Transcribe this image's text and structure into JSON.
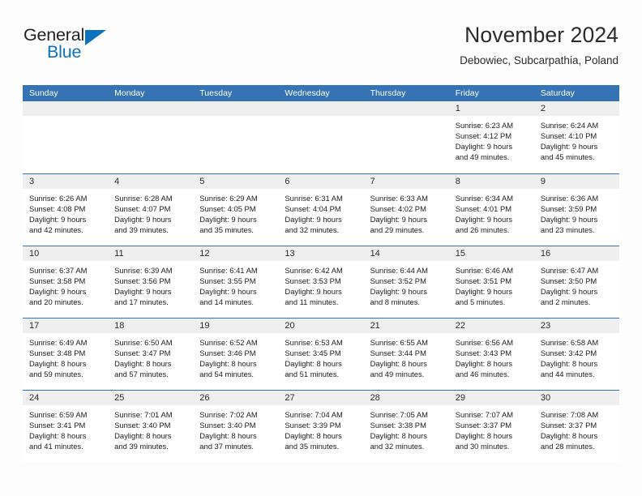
{
  "brand": {
    "name_part1": "General",
    "name_part2": "Blue",
    "triangle_color": "#0d72bb",
    "text_color": "#231f20"
  },
  "header": {
    "title": "November 2024",
    "subtitle": "Debowiec, Subcarpathia, Poland"
  },
  "colors": {
    "header_blue": "#3573b4",
    "date_strip_gray": "#efefef",
    "cell_white": "#ffffff",
    "page_background": "#fdfdfd",
    "text": "#1c1c1c"
  },
  "weekdays": [
    "Sunday",
    "Monday",
    "Tuesday",
    "Wednesday",
    "Thursday",
    "Friday",
    "Saturday"
  ],
  "weeks": [
    [
      {
        "day": "",
        "sunrise": "",
        "sunset": "",
        "daylight1": "",
        "daylight2": "",
        "empty": true
      },
      {
        "day": "",
        "sunrise": "",
        "sunset": "",
        "daylight1": "",
        "daylight2": "",
        "empty": true
      },
      {
        "day": "",
        "sunrise": "",
        "sunset": "",
        "daylight1": "",
        "daylight2": "",
        "empty": true
      },
      {
        "day": "",
        "sunrise": "",
        "sunset": "",
        "daylight1": "",
        "daylight2": "",
        "empty": true
      },
      {
        "day": "",
        "sunrise": "",
        "sunset": "",
        "daylight1": "",
        "daylight2": "",
        "empty": true
      },
      {
        "day": "1",
        "sunrise": "Sunrise: 6:23 AM",
        "sunset": "Sunset: 4:12 PM",
        "daylight1": "Daylight: 9 hours",
        "daylight2": "and 49 minutes.",
        "empty": false
      },
      {
        "day": "2",
        "sunrise": "Sunrise: 6:24 AM",
        "sunset": "Sunset: 4:10 PM",
        "daylight1": "Daylight: 9 hours",
        "daylight2": "and 45 minutes.",
        "empty": false
      }
    ],
    [
      {
        "day": "3",
        "sunrise": "Sunrise: 6:26 AM",
        "sunset": "Sunset: 4:08 PM",
        "daylight1": "Daylight: 9 hours",
        "daylight2": "and 42 minutes.",
        "empty": false
      },
      {
        "day": "4",
        "sunrise": "Sunrise: 6:28 AM",
        "sunset": "Sunset: 4:07 PM",
        "daylight1": "Daylight: 9 hours",
        "daylight2": "and 39 minutes.",
        "empty": false
      },
      {
        "day": "5",
        "sunrise": "Sunrise: 6:29 AM",
        "sunset": "Sunset: 4:05 PM",
        "daylight1": "Daylight: 9 hours",
        "daylight2": "and 35 minutes.",
        "empty": false
      },
      {
        "day": "6",
        "sunrise": "Sunrise: 6:31 AM",
        "sunset": "Sunset: 4:04 PM",
        "daylight1": "Daylight: 9 hours",
        "daylight2": "and 32 minutes.",
        "empty": false
      },
      {
        "day": "7",
        "sunrise": "Sunrise: 6:33 AM",
        "sunset": "Sunset: 4:02 PM",
        "daylight1": "Daylight: 9 hours",
        "daylight2": "and 29 minutes.",
        "empty": false
      },
      {
        "day": "8",
        "sunrise": "Sunrise: 6:34 AM",
        "sunset": "Sunset: 4:01 PM",
        "daylight1": "Daylight: 9 hours",
        "daylight2": "and 26 minutes.",
        "empty": false
      },
      {
        "day": "9",
        "sunrise": "Sunrise: 6:36 AM",
        "sunset": "Sunset: 3:59 PM",
        "daylight1": "Daylight: 9 hours",
        "daylight2": "and 23 minutes.",
        "empty": false
      }
    ],
    [
      {
        "day": "10",
        "sunrise": "Sunrise: 6:37 AM",
        "sunset": "Sunset: 3:58 PM",
        "daylight1": "Daylight: 9 hours",
        "daylight2": "and 20 minutes.",
        "empty": false
      },
      {
        "day": "11",
        "sunrise": "Sunrise: 6:39 AM",
        "sunset": "Sunset: 3:56 PM",
        "daylight1": "Daylight: 9 hours",
        "daylight2": "and 17 minutes.",
        "empty": false
      },
      {
        "day": "12",
        "sunrise": "Sunrise: 6:41 AM",
        "sunset": "Sunset: 3:55 PM",
        "daylight1": "Daylight: 9 hours",
        "daylight2": "and 14 minutes.",
        "empty": false
      },
      {
        "day": "13",
        "sunrise": "Sunrise: 6:42 AM",
        "sunset": "Sunset: 3:53 PM",
        "daylight1": "Daylight: 9 hours",
        "daylight2": "and 11 minutes.",
        "empty": false
      },
      {
        "day": "14",
        "sunrise": "Sunrise: 6:44 AM",
        "sunset": "Sunset: 3:52 PM",
        "daylight1": "Daylight: 9 hours",
        "daylight2": "and 8 minutes.",
        "empty": false
      },
      {
        "day": "15",
        "sunrise": "Sunrise: 6:46 AM",
        "sunset": "Sunset: 3:51 PM",
        "daylight1": "Daylight: 9 hours",
        "daylight2": "and 5 minutes.",
        "empty": false
      },
      {
        "day": "16",
        "sunrise": "Sunrise: 6:47 AM",
        "sunset": "Sunset: 3:50 PM",
        "daylight1": "Daylight: 9 hours",
        "daylight2": "and 2 minutes.",
        "empty": false
      }
    ],
    [
      {
        "day": "17",
        "sunrise": "Sunrise: 6:49 AM",
        "sunset": "Sunset: 3:48 PM",
        "daylight1": "Daylight: 8 hours",
        "daylight2": "and 59 minutes.",
        "empty": false
      },
      {
        "day": "18",
        "sunrise": "Sunrise: 6:50 AM",
        "sunset": "Sunset: 3:47 PM",
        "daylight1": "Daylight: 8 hours",
        "daylight2": "and 57 minutes.",
        "empty": false
      },
      {
        "day": "19",
        "sunrise": "Sunrise: 6:52 AM",
        "sunset": "Sunset: 3:46 PM",
        "daylight1": "Daylight: 8 hours",
        "daylight2": "and 54 minutes.",
        "empty": false
      },
      {
        "day": "20",
        "sunrise": "Sunrise: 6:53 AM",
        "sunset": "Sunset: 3:45 PM",
        "daylight1": "Daylight: 8 hours",
        "daylight2": "and 51 minutes.",
        "empty": false
      },
      {
        "day": "21",
        "sunrise": "Sunrise: 6:55 AM",
        "sunset": "Sunset: 3:44 PM",
        "daylight1": "Daylight: 8 hours",
        "daylight2": "and 49 minutes.",
        "empty": false
      },
      {
        "day": "22",
        "sunrise": "Sunrise: 6:56 AM",
        "sunset": "Sunset: 3:43 PM",
        "daylight1": "Daylight: 8 hours",
        "daylight2": "and 46 minutes.",
        "empty": false
      },
      {
        "day": "23",
        "sunrise": "Sunrise: 6:58 AM",
        "sunset": "Sunset: 3:42 PM",
        "daylight1": "Daylight: 8 hours",
        "daylight2": "and 44 minutes.",
        "empty": false
      }
    ],
    [
      {
        "day": "24",
        "sunrise": "Sunrise: 6:59 AM",
        "sunset": "Sunset: 3:41 PM",
        "daylight1": "Daylight: 8 hours",
        "daylight2": "and 41 minutes.",
        "empty": false
      },
      {
        "day": "25",
        "sunrise": "Sunrise: 7:01 AM",
        "sunset": "Sunset: 3:40 PM",
        "daylight1": "Daylight: 8 hours",
        "daylight2": "and 39 minutes.",
        "empty": false
      },
      {
        "day": "26",
        "sunrise": "Sunrise: 7:02 AM",
        "sunset": "Sunset: 3:40 PM",
        "daylight1": "Daylight: 8 hours",
        "daylight2": "and 37 minutes.",
        "empty": false
      },
      {
        "day": "27",
        "sunrise": "Sunrise: 7:04 AM",
        "sunset": "Sunset: 3:39 PM",
        "daylight1": "Daylight: 8 hours",
        "daylight2": "and 35 minutes.",
        "empty": false
      },
      {
        "day": "28",
        "sunrise": "Sunrise: 7:05 AM",
        "sunset": "Sunset: 3:38 PM",
        "daylight1": "Daylight: 8 hours",
        "daylight2": "and 32 minutes.",
        "empty": false
      },
      {
        "day": "29",
        "sunrise": "Sunrise: 7:07 AM",
        "sunset": "Sunset: 3:37 PM",
        "daylight1": "Daylight: 8 hours",
        "daylight2": "and 30 minutes.",
        "empty": false
      },
      {
        "day": "30",
        "sunrise": "Sunrise: 7:08 AM",
        "sunset": "Sunset: 3:37 PM",
        "daylight1": "Daylight: 8 hours",
        "daylight2": "and 28 minutes.",
        "empty": false
      }
    ]
  ]
}
